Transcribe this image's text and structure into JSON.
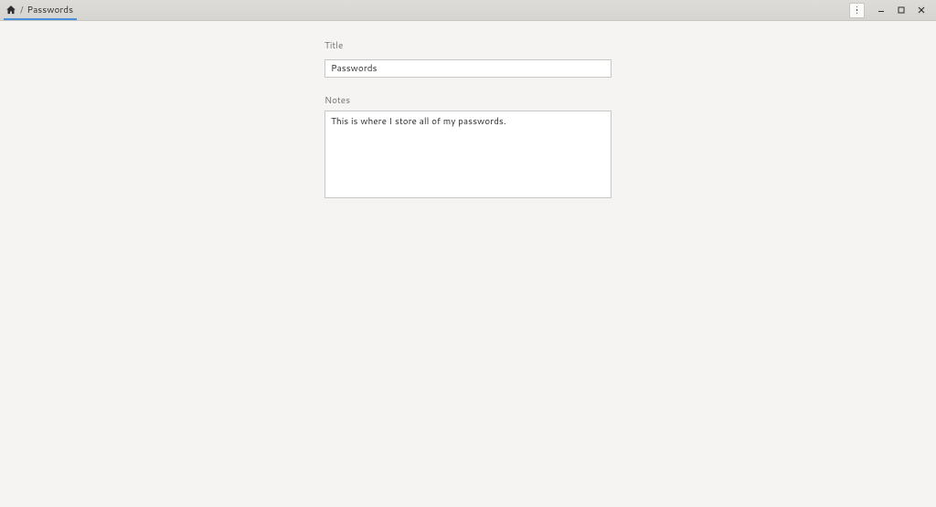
{
  "breadcrumb": {
    "separator": "/",
    "title": "Passwords"
  },
  "form": {
    "title_label": "Title",
    "title_value": "Passwords",
    "notes_label": "Notes",
    "notes_value": "This is where I store all of my passwords."
  },
  "window": {
    "minimize": "—",
    "maximize": "▢",
    "close": "✕"
  }
}
